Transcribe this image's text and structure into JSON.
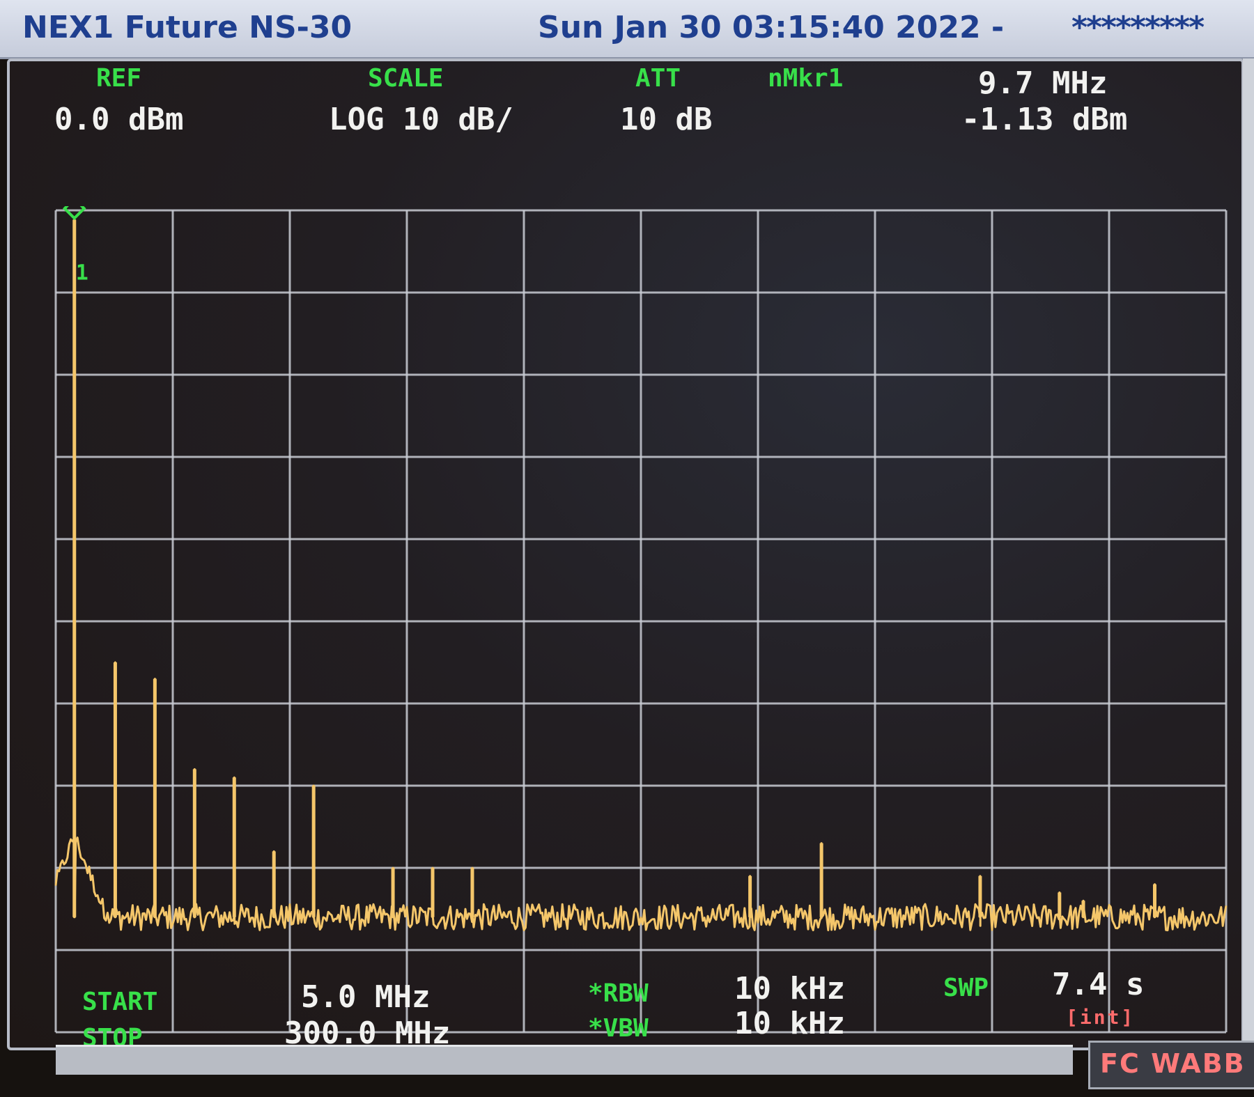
{
  "titlebar": {
    "device": "NEX1 Future NS-30",
    "datetime": "Sun Jan 30 03:15:40 2022 -",
    "masked": "*********"
  },
  "header": {
    "ref_label": "REF",
    "ref_value": "0.0 dBm",
    "scale_label": "SCALE",
    "scale_value": "LOG 10 dB/",
    "att_label": "ATT",
    "att_value": "10 dB",
    "marker_label": "nMkr1",
    "marker_freq": "9.7 MHz",
    "marker_level": "-1.13 dBm",
    "marker_id": "1"
  },
  "footer": {
    "start_label": "START",
    "start_value": "5.0 MHz",
    "stop_label": "STOP",
    "stop_value": "300.0 MHz",
    "rbw_label": "*RBW",
    "rbw_value": "10 kHz",
    "vbw_label": "*VBW",
    "vbw_value": "10 kHz",
    "swp_label": "SWP",
    "swp_value": "7.4 s",
    "swp_mode": "[int]",
    "status": "FC WABB"
  },
  "colors": {
    "trace": "#f4c66a",
    "grid": "#c9ccd4",
    "label_green": "#38e04a",
    "value_white": "#f2f2f0",
    "status_red": "#ff6b6b"
  },
  "chart_data": {
    "type": "line",
    "x_unit": "MHz",
    "y_unit": "dBm",
    "xlim": [
      5.0,
      300.0
    ],
    "ylim": [
      -100,
      0
    ],
    "grid": true,
    "grid_divisions": {
      "x": 10,
      "y": 10
    },
    "noise_floor_dbm": -86,
    "peaks": [
      {
        "x": 9.7,
        "y": -1.13
      },
      {
        "x": 20.0,
        "y": -55
      },
      {
        "x": 30.0,
        "y": -57
      },
      {
        "x": 40.0,
        "y": -68
      },
      {
        "x": 50.0,
        "y": -69
      },
      {
        "x": 60.0,
        "y": -78
      },
      {
        "x": 70.0,
        "y": -70
      },
      {
        "x": 90.0,
        "y": -80
      },
      {
        "x": 100.0,
        "y": -80
      },
      {
        "x": 110.0,
        "y": -80
      },
      {
        "x": 180.0,
        "y": -81
      },
      {
        "x": 198.0,
        "y": -77
      },
      {
        "x": 238.0,
        "y": -81
      },
      {
        "x": 258.0,
        "y": -83
      },
      {
        "x": 264.0,
        "y": -84
      },
      {
        "x": 282.0,
        "y": -82
      }
    ]
  }
}
